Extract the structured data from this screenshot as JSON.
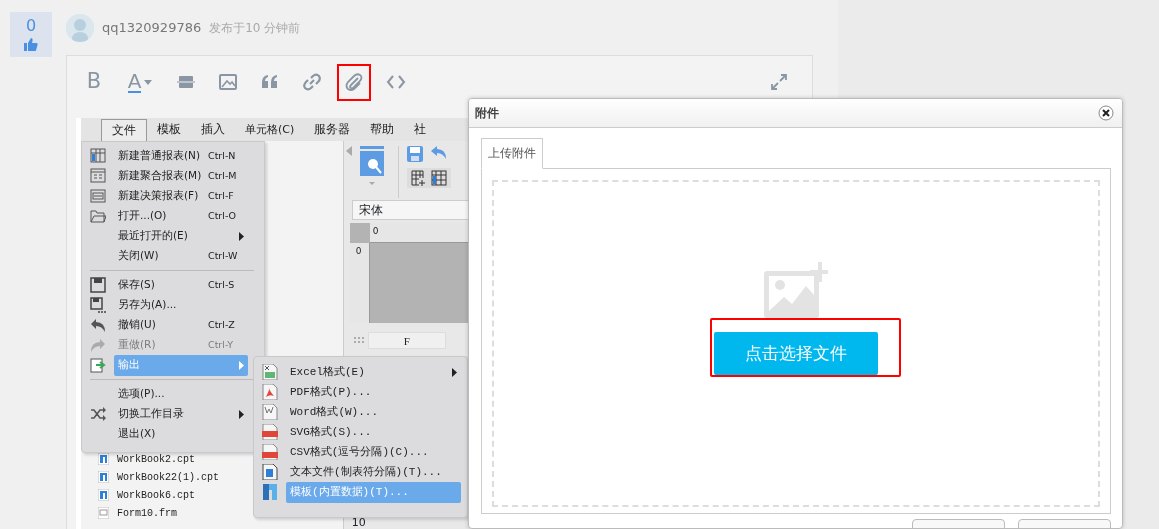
{
  "post": {
    "votes": "0",
    "author": "qq1320929786",
    "time": "发布于10 分钟前"
  },
  "editor": {
    "toolbar": [
      {
        "kind": "bold",
        "glyph": "B",
        "highlighted": false
      },
      {
        "kind": "font-color",
        "glyph": "A",
        "highlighted": false
      },
      {
        "kind": "divider",
        "highlighted": false
      },
      {
        "kind": "image",
        "highlighted": false
      },
      {
        "kind": "quote",
        "highlighted": false
      },
      {
        "kind": "link",
        "highlighted": false
      },
      {
        "kind": "attachment",
        "highlighted": true
      },
      {
        "kind": "code",
        "highlighted": false
      },
      {
        "kind": "fullscreen",
        "highlighted": false
      }
    ]
  },
  "embedded_app": {
    "menubar": [
      {
        "label": "文件",
        "selected": true
      },
      {
        "label": "模板",
        "selected": false
      },
      {
        "label": "插入",
        "selected": false
      },
      {
        "label": "单元格(C)",
        "selected": false
      },
      {
        "label": "服务器",
        "selected": false
      },
      {
        "label": "帮助",
        "selected": false
      },
      {
        "label": "社",
        "selected": false
      }
    ],
    "font_field": "宋体",
    "ruler_labels": [
      "0",
      "0"
    ],
    "column_header": "F",
    "row_numbers": [
      "10"
    ],
    "files": [
      {
        "name": "WorkBook2.cpt",
        "kind": "cpt"
      },
      {
        "name": "WorkBook22(1).cpt",
        "kind": "cpt"
      },
      {
        "name": "WorkBook6.cpt",
        "kind": "cpt"
      },
      {
        "name": "Form10.frm",
        "kind": "frm"
      }
    ],
    "file_menu": [
      {
        "kind": "grid",
        "label": "新建普通报表(N)",
        "shortcut": "Ctrl-N",
        "submenu": false,
        "disabled": false,
        "selected": false
      },
      {
        "kind": "form",
        "label": "新建聚合报表(M)",
        "shortcut": "Ctrl-M",
        "submenu": false,
        "disabled": false,
        "selected": false
      },
      {
        "kind": "decision",
        "label": "新建决策报表(F)",
        "shortcut": "Ctrl-F",
        "submenu": false,
        "disabled": false,
        "selected": false
      },
      {
        "kind": "folder",
        "label": "打开...(O)",
        "shortcut": "Ctrl-O",
        "submenu": false,
        "disabled": false,
        "selected": false
      },
      {
        "kind": "plain",
        "label": "最近打开的(E)",
        "submenu": true,
        "disabled": false,
        "selected": false
      },
      {
        "kind": "plain",
        "label": "关闭(W)",
        "shortcut": "Ctrl-W",
        "submenu": false,
        "disabled": false,
        "selected": false
      },
      {
        "kind": "divider"
      },
      {
        "kind": "save",
        "label": "保存(S)",
        "shortcut": "Ctrl-S",
        "submenu": false,
        "disabled": false,
        "selected": false
      },
      {
        "kind": "saveas",
        "label": "另存为(A)...",
        "submenu": false,
        "disabled": false,
        "selected": false
      },
      {
        "kind": "undo",
        "label": "撤销(U)",
        "shortcut": "Ctrl-Z",
        "submenu": false,
        "disabled": false,
        "selected": false
      },
      {
        "kind": "redo",
        "label": "重做(R)",
        "shortcut": "Ctrl-Y",
        "submenu": false,
        "disabled": true,
        "selected": false
      },
      {
        "kind": "export",
        "label": "输出",
        "submenu": true,
        "disabled": false,
        "selected": true
      },
      {
        "kind": "divider"
      },
      {
        "kind": "plain",
        "label": "选项(P)...",
        "submenu": false,
        "disabled": false,
        "selected": false
      },
      {
        "kind": "shuffle",
        "label": "切换工作目录",
        "submenu": true,
        "disabled": false,
        "selected": false
      },
      {
        "kind": "plain",
        "label": "退出(X)",
        "submenu": false,
        "disabled": false,
        "selected": false
      }
    ],
    "export_menu": [
      {
        "kind": "excel",
        "label": "Excel格式(E)",
        "submenu": true,
        "selected": false
      },
      {
        "kind": "pdf",
        "label": "PDF格式(P)...",
        "submenu": false,
        "selected": false
      },
      {
        "kind": "word",
        "label": "Word格式(W)...",
        "submenu": false,
        "selected": false
      },
      {
        "kind": "svg",
        "label": "SVG格式(S)...",
        "submenu": false,
        "selected": false
      },
      {
        "kind": "csv",
        "label": "CSV格式(逗号分隔)(C)...",
        "submenu": false,
        "selected": false
      },
      {
        "kind": "text",
        "label": "文本文件(制表符分隔)(T)...",
        "submenu": false,
        "selected": false
      },
      {
        "kind": "template",
        "label": "模板(内置数据)(T)...",
        "submenu": false,
        "selected": true
      }
    ]
  },
  "dialog": {
    "title": "附件",
    "tabs": [
      {
        "label": "上传附件",
        "selected": true
      }
    ],
    "upload_button": "点击选择文件",
    "upload_highlighted": true,
    "footer_buttons": [
      {
        "kind": "button"
      },
      {
        "kind": "button"
      }
    ]
  }
}
